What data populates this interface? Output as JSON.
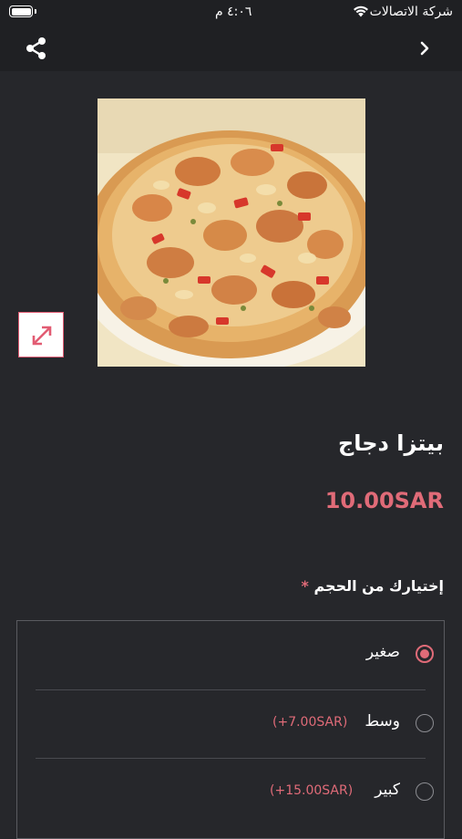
{
  "status_bar": {
    "carrier": "شركة الاتصالات",
    "time": "٤:٠٦ م"
  },
  "nav": {
    "share_icon": "share-icon",
    "back_icon": "chevron-right-icon"
  },
  "product": {
    "image_icon": "pizza-photo",
    "expand_icon": "expand-arrows-icon",
    "name": "بيتزا دجاج",
    "price": "10.00SAR"
  },
  "size_selector": {
    "heading": "إختيارك من الحجم",
    "required_mark": "*",
    "options": [
      {
        "label": "صغير",
        "extra": "",
        "selected": true
      },
      {
        "label": "وسط",
        "extra": "(+7.00SAR)",
        "selected": false
      },
      {
        "label": "كبير",
        "extra": "(+15.00SAR)",
        "selected": false
      }
    ]
  },
  "colors": {
    "background": "#26272b",
    "bar": "#1f2023",
    "accent": "#e06b78"
  }
}
